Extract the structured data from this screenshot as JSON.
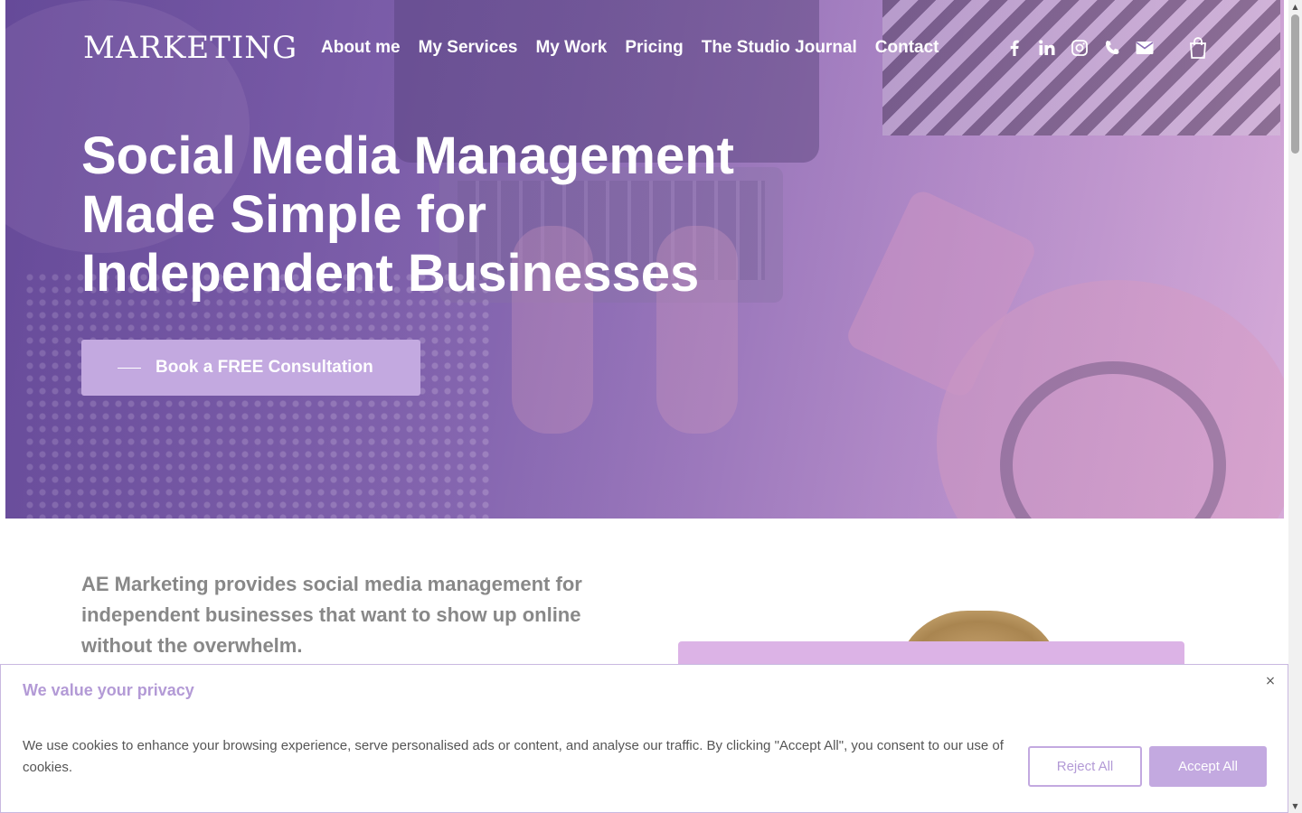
{
  "brand": {
    "logo_text": "MARKETING",
    "colors": {
      "hero_gradient_start": "#6a4f9c",
      "hero_gradient_end": "#d7aed9",
      "accent": "#c3a9e0",
      "cookie_title": "#b39ad6",
      "intro_text": "#888888"
    }
  },
  "nav": {
    "items": [
      "About me",
      "My Services",
      "My Work",
      "Pricing",
      "The Studio Journal",
      "Contact"
    ],
    "social_icons": [
      "facebook-icon",
      "linkedin-icon",
      "instagram-icon",
      "phone-icon",
      "email-icon"
    ],
    "cart_icon": "shopping-bag-icon"
  },
  "hero": {
    "title_lines": [
      "Social Media Management",
      "Made Simple for",
      "Independent Businesses"
    ],
    "cta_label": "Book a FREE Consultation"
  },
  "intro": {
    "text": "AE Marketing provides social media management for independent businesses that want to show up online without the overwhelm."
  },
  "cookie_banner": {
    "title": "We value your privacy",
    "text": "We use cookies to enhance your browsing experience, serve personalised ads or content, and analyse our traffic. By clicking \"Accept All\", you consent to our use of cookies.",
    "reject_label": "Reject All",
    "accept_label": "Accept All",
    "close_symbol": "×"
  },
  "scrollbar": {
    "up_symbol": "▲",
    "down_symbol": "▼"
  }
}
